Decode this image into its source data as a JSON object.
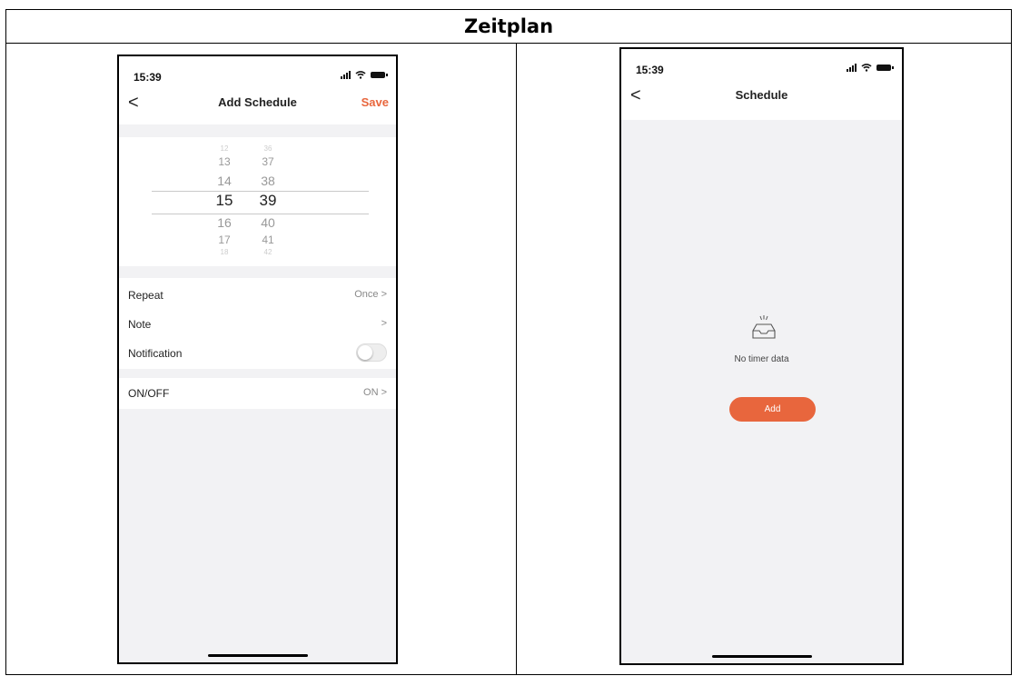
{
  "document": {
    "title": "Zeitplan"
  },
  "left_screen": {
    "status": {
      "time": "15:39"
    },
    "nav": {
      "back": "<",
      "title": "Add Schedule",
      "save": "Save"
    },
    "picker": {
      "hours": [
        "12",
        "13",
        "14",
        "15",
        "16",
        "17",
        "18"
      ],
      "minutes": [
        "36",
        "37",
        "38",
        "39",
        "40",
        "41",
        "42"
      ],
      "selected_hour": "15",
      "selected_minute": "39"
    },
    "rows": {
      "repeat": {
        "label": "Repeat",
        "value": "Once >"
      },
      "note": {
        "label": "Note",
        "value": ">"
      },
      "notification": {
        "label": "Notification",
        "enabled": false
      },
      "onoff": {
        "label": "ON/OFF",
        "value": "ON >"
      }
    }
  },
  "right_screen": {
    "status": {
      "time": "15:39"
    },
    "nav": {
      "back": "<",
      "title": "Schedule"
    },
    "empty_icon": "empty-inbox-icon",
    "empty_text": "No timer data",
    "add_label": "Add"
  },
  "colors": {
    "accent": "#e8663d",
    "background_gray": "#f2f2f4"
  }
}
